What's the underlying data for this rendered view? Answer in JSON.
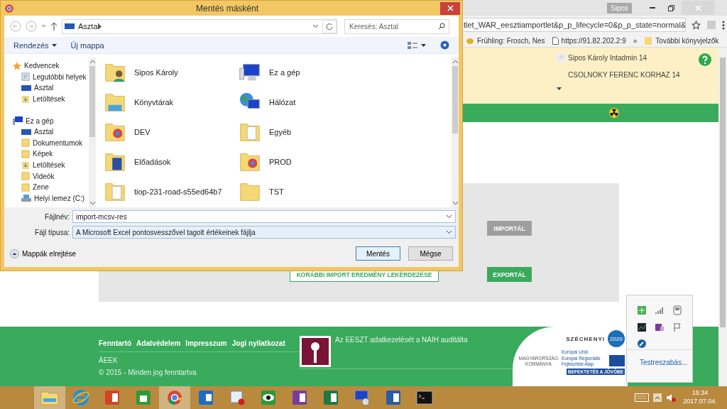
{
  "browser": {
    "profile": "Sipos",
    "url": "tlet_WAR_eesztiamportlet&p_p_lifecycle=0&p_p_state=normal&",
    "bookmarks": [
      {
        "label": "Frühling: Frosch, Nes",
        "kind": "site"
      },
      {
        "label": "https://91.82.202.2:9",
        "kind": "page"
      }
    ],
    "overflow": "»",
    "other_bookmarks": "További könyvjelzők"
  },
  "page": {
    "user": "Sipos Károly Intadmin 14",
    "org": "CSOLNOKY FERENC KORHAZ 14",
    "actions": [
      {
        "label": "IMPORTÁL",
        "kind": "primary",
        "disabled": true
      },
      {
        "label": "KORÁBBI IMPORT EREDMÉNY LEKÉRDEZÉSE",
        "kind": "outline",
        "disabled": false
      },
      {
        "label": "EXPORTÁL",
        "kind": "primary",
        "disabled": false
      }
    ],
    "footer": {
      "links": [
        "Fenntartó",
        "Adatvédelem",
        "Impresszum",
        "Jogi nyilatkozat"
      ],
      "org": "ÁEEK",
      "copyright": "© 2015 - Minden jog fenntartva",
      "audit": "Az EESZT adatkezelését a NAIH auditálta",
      "logos": {
        "szechenyi": "SZÉCHENYI",
        "year": "2020",
        "gov": "MAGYARORSZÁG KORMÁNYA",
        "eu": "Európai Unió",
        "fund": "Európai Regionális Fejlesztési Alap",
        "slogan": "BEFEKTETÉS A JÖVŐBE"
      }
    }
  },
  "dialog": {
    "title": "Mentés másként",
    "address": "Asztal",
    "search": {
      "placeholder": "Keresés: Asztal"
    },
    "toolbar": [
      {
        "label": "Rendezés",
        "kind": "menu"
      },
      {
        "label": "Új mappa",
        "kind": "button"
      }
    ],
    "tree": [
      {
        "label": "Kedvencek",
        "kind": "star",
        "children": [
          {
            "label": "Legutóbbi helyek",
            "kind": "recent"
          },
          {
            "label": "Asztal",
            "kind": "desktop"
          },
          {
            "label": "Letöltések",
            "kind": "downloads"
          }
        ]
      },
      {
        "label": "Ez a gép",
        "kind": "computer",
        "children": [
          {
            "label": "Asztal",
            "kind": "desktop"
          },
          {
            "label": "Dokumentumok",
            "kind": "folder"
          },
          {
            "label": "Képek",
            "kind": "folder"
          },
          {
            "label": "Letöltések",
            "kind": "downloads"
          },
          {
            "label": "Videók",
            "kind": "folder"
          },
          {
            "label": "Zene",
            "kind": "folder"
          },
          {
            "label": "Helyi lemez (C:)",
            "kind": "drive"
          }
        ]
      }
    ],
    "files": [
      {
        "name": "Sipos Károly",
        "kind": "user"
      },
      {
        "name": "Ez a gép",
        "kind": "computer"
      },
      {
        "name": "Könyvtárak",
        "kind": "library"
      },
      {
        "name": "Hálózat",
        "kind": "network"
      },
      {
        "name": "DEV",
        "kind": "folder-app"
      },
      {
        "name": "Egyéb",
        "kind": "folder-doc"
      },
      {
        "name": "Előadások",
        "kind": "folder-blue"
      },
      {
        "name": "PROD",
        "kind": "folder-app"
      },
      {
        "name": "tiop-231-road-s55ed64b7",
        "kind": "folder-doc"
      },
      {
        "name": "TST",
        "kind": "folder"
      }
    ],
    "filename": {
      "label": "Fájlnév:",
      "value": "import-mcsv-res"
    },
    "filetype": {
      "label": "Fájl típusa:",
      "value": "A Microsoft Excel pontosvesszővel tagolt értékeinek fájlja"
    },
    "hide_folders": "Mappák elrejtése",
    "buttons": [
      {
        "label": "Mentés",
        "default": true
      },
      {
        "label": "Mégse",
        "default": false
      }
    ]
  },
  "tray": {
    "icons": [
      {
        "kind": "green"
      },
      {
        "kind": "signal"
      },
      {
        "kind": "device"
      },
      {
        "kind": "chart"
      },
      {
        "kind": "onenote"
      },
      {
        "kind": "flag"
      },
      {
        "kind": "tool"
      }
    ],
    "customize": "Testreszabás..."
  },
  "taskbar": {
    "apps": [
      {
        "kind": "explorer",
        "selected": true
      },
      {
        "kind": "ie",
        "selected": false
      },
      {
        "kind": "powerpoint",
        "selected": false
      },
      {
        "kind": "store",
        "selected": false
      },
      {
        "kind": "chrome",
        "selected": true
      },
      {
        "kind": "outlook",
        "selected": false
      },
      {
        "kind": "record",
        "selected": false
      },
      {
        "kind": "eye",
        "selected": false
      },
      {
        "kind": "onenote",
        "selected": false
      },
      {
        "kind": "excel",
        "selected": false
      },
      {
        "kind": "remote",
        "selected": false
      },
      {
        "kind": "word",
        "selected": false
      },
      {
        "kind": "console",
        "selected": false
      }
    ],
    "clock": {
      "time": "15:34",
      "date": "2017.07.04."
    }
  }
}
